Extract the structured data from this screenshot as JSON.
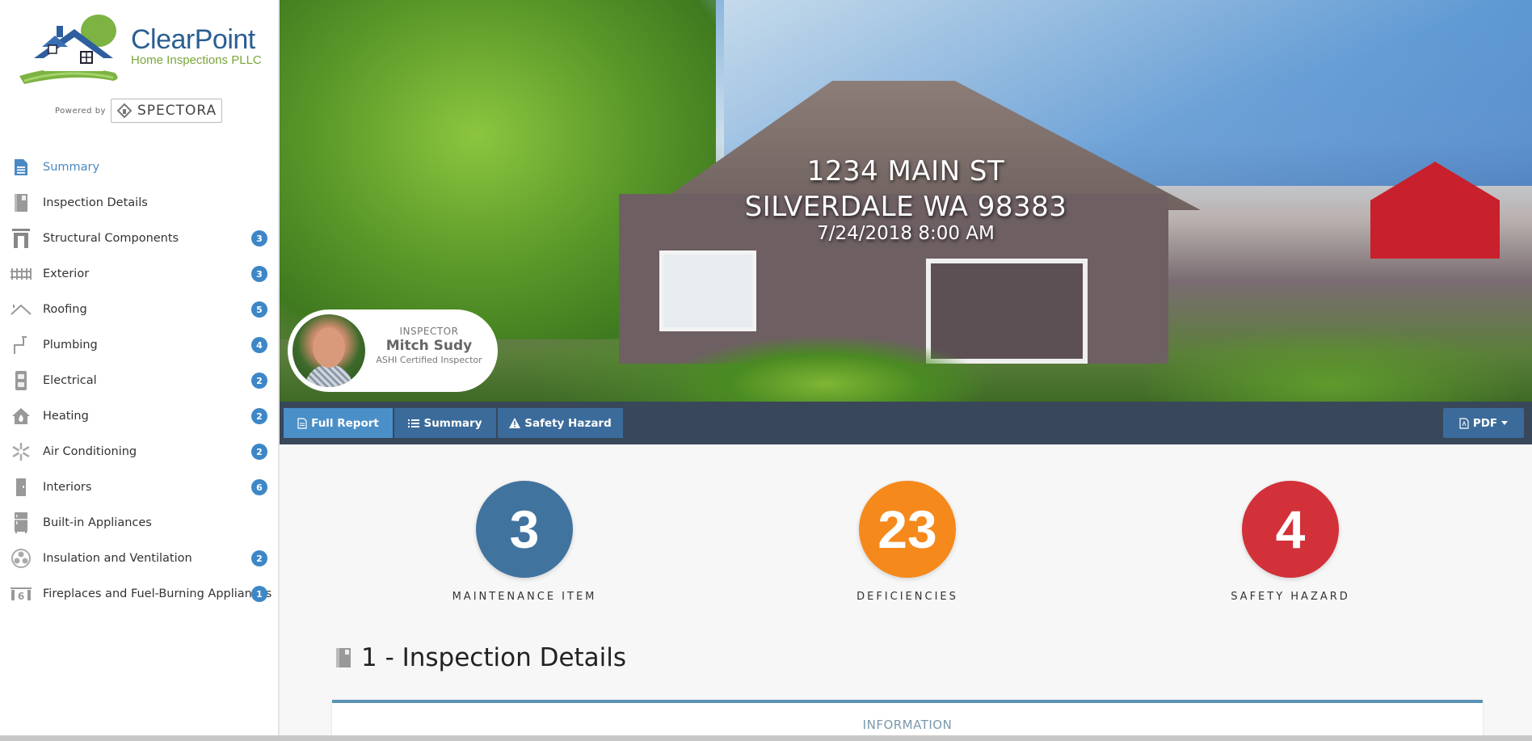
{
  "brand": {
    "name": "ClearPoint",
    "subtitle": "Home Inspections PLLC",
    "powered_by": "Powered by",
    "platform": "SPECTORA"
  },
  "sidebar": {
    "items": [
      {
        "label": "Summary",
        "icon": "document-icon",
        "badge": null,
        "active": true
      },
      {
        "label": "Inspection Details",
        "icon": "notebook-icon",
        "badge": null
      },
      {
        "label": "Structural Components",
        "icon": "doorframe-icon",
        "badge": "3"
      },
      {
        "label": "Exterior",
        "icon": "fence-icon",
        "badge": "3"
      },
      {
        "label": "Roofing",
        "icon": "roof-icon",
        "badge": "5"
      },
      {
        "label": "Plumbing",
        "icon": "pipe-icon",
        "badge": "4"
      },
      {
        "label": "Electrical",
        "icon": "outlet-icon",
        "badge": "2"
      },
      {
        "label": "Heating",
        "icon": "house-flame-icon",
        "badge": "2"
      },
      {
        "label": "Air Conditioning",
        "icon": "snowflake-icon",
        "badge": "2"
      },
      {
        "label": "Interiors",
        "icon": "door-icon",
        "badge": "6"
      },
      {
        "label": "Built-in Appliances",
        "icon": "fridge-icon",
        "badge": null
      },
      {
        "label": "Insulation and Ventilation",
        "icon": "fan-icon",
        "badge": "2"
      },
      {
        "label": "Fireplaces and Fuel-Burning Appliances",
        "icon": "fireplace-icon",
        "badge": "1"
      }
    ]
  },
  "hero": {
    "address_line1": "1234 MAIN ST",
    "address_line2": "SILVERDALE WA 98383",
    "datetime": "7/24/2018 8:00 AM"
  },
  "inspector": {
    "role": "INSPECTOR",
    "name": "Mitch Sudy",
    "certification": "ASHI Certified Inspector"
  },
  "toolbar": {
    "full_report": "Full Report",
    "summary": "Summary",
    "safety_hazard": "Safety Hazard",
    "pdf": "PDF"
  },
  "stats": [
    {
      "value": "3",
      "label": "MAINTENANCE ITEM",
      "color": "#41739f"
    },
    {
      "value": "23",
      "label": "DEFICIENCIES",
      "color": "#f5891c"
    },
    {
      "value": "4",
      "label": "SAFETY HAZARD",
      "color": "#d2313a"
    }
  ],
  "section": {
    "title": "1 - Inspection Details",
    "card_label": "INFORMATION"
  },
  "colors": {
    "accent": "#4a8ac2",
    "badge": "#3d87c7",
    "toolbar_bg": "#38475a"
  }
}
